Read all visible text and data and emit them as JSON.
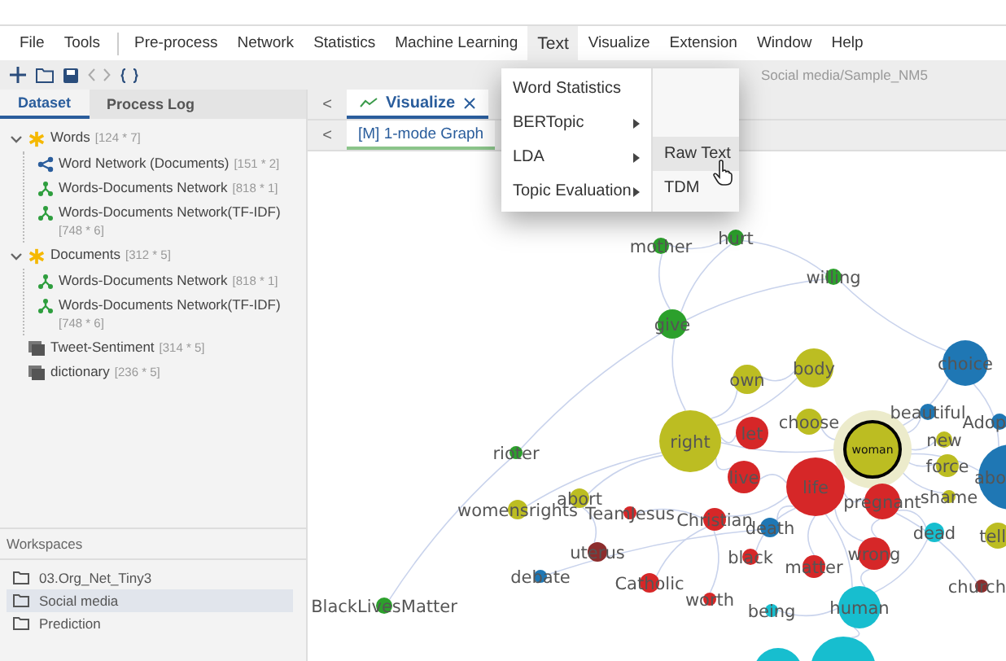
{
  "menu_bar": {
    "items": [
      {
        "label": "File",
        "kind": "item",
        "selected": false
      },
      {
        "label": "Tools",
        "kind": "item",
        "selected": false
      },
      {
        "kind": "separator"
      },
      {
        "label": "Pre-process",
        "kind": "item",
        "selected": false
      },
      {
        "label": "Network",
        "kind": "item",
        "selected": false
      },
      {
        "label": "Statistics",
        "kind": "item",
        "selected": false
      },
      {
        "label": "Machine Learning",
        "kind": "item",
        "selected": false
      },
      {
        "label": "Text",
        "kind": "item",
        "selected": true
      },
      {
        "label": "Visualize",
        "kind": "item",
        "selected": false
      },
      {
        "label": "Extension",
        "kind": "item",
        "selected": false
      },
      {
        "label": "Window",
        "kind": "item",
        "selected": false
      },
      {
        "label": "Help",
        "kind": "item",
        "selected": false
      }
    ]
  },
  "open_menu": {
    "items": [
      {
        "label": "Word Statistics",
        "kind": "item"
      },
      {
        "label": "BERTopic",
        "kind": "submenu"
      },
      {
        "label": "LDA",
        "kind": "submenu"
      },
      {
        "label": "Topic Evaluation",
        "kind": "submenu"
      }
    ]
  },
  "submenu": {
    "items": [
      {
        "label": "Raw Text",
        "selected": true
      },
      {
        "label": "TDM",
        "selected": false
      }
    ]
  },
  "breadcrumb": "Social media/Sample_NM5",
  "panel_tabs": [
    {
      "label": "Dataset",
      "selected": true
    },
    {
      "label": "Process Log",
      "selected": false
    }
  ],
  "tree": [
    {
      "label": "Words",
      "count": "[124 * 7]",
      "kind": "group",
      "expanded": true,
      "children": [
        {
          "label": "Word Network (Documents)",
          "count": "[151 * 2]",
          "kind": "network"
        },
        {
          "label": "Words-Documents Network",
          "count": "[818 * 1]",
          "kind": "bipartite"
        },
        {
          "label": "Words-Documents Network(TF-IDF)",
          "count": "[748 * 6]",
          "kind": "bipartite"
        }
      ]
    },
    {
      "label": "Documents",
      "count": "[312 * 5]",
      "kind": "group",
      "expanded": true,
      "children": [
        {
          "label": "Words-Documents Network",
          "count": "[818 * 1]",
          "kind": "bipartite"
        },
        {
          "label": "Words-Documents Network(TF-IDF)",
          "count": "[748 * 6]",
          "kind": "bipartite"
        }
      ]
    },
    {
      "label": "Tweet-Sentiment",
      "count": "[314 * 5]",
      "kind": "table"
    },
    {
      "label": "dictionary",
      "count": "[236 * 5]",
      "kind": "table"
    }
  ],
  "workspaces": {
    "title": "Workspaces",
    "items": [
      {
        "label": "03.Org_Net_Tiny3",
        "selected": false
      },
      {
        "label": "Social media",
        "selected": true
      },
      {
        "label": "Prediction",
        "selected": false
      }
    ]
  },
  "editor_tabs": {
    "scroll_button": "<",
    "tabs": [
      {
        "label": "Visualize",
        "selected": true
      }
    ]
  },
  "view_tabs": {
    "scroll_button": "<",
    "tabs": [
      {
        "label": "[M] 1-mode Graph",
        "selected": true
      }
    ]
  },
  "graph": {
    "nodes": [
      {
        "label": "mother",
        "color": "#2ca02c",
        "selected": false
      },
      {
        "label": "hurt",
        "color": "#2ca02c",
        "selected": false
      },
      {
        "label": "willing",
        "color": "#2ca02c",
        "selected": false
      },
      {
        "label": "give",
        "color": "#2ca02c",
        "selected": false
      },
      {
        "label": "own",
        "color": "#bcbd22",
        "selected": false
      },
      {
        "label": "body",
        "color": "#bcbd22",
        "selected": false
      },
      {
        "label": "choice",
        "color": "#1f77b4",
        "selected": false
      },
      {
        "label": "rioter",
        "color": "#2ca02c",
        "selected": false
      },
      {
        "label": "right",
        "color": "#bcbd22",
        "selected": false
      },
      {
        "label": "let",
        "color": "#d62728",
        "selected": false
      },
      {
        "label": "choose",
        "color": "#bcbd22",
        "selected": false
      },
      {
        "label": "woman",
        "color": "#bcbd22",
        "selected": true
      },
      {
        "label": "beautiful",
        "color": "#1f77b4",
        "selected": false
      },
      {
        "label": "new",
        "color": "#bcbd22",
        "selected": false
      },
      {
        "label": "Adop",
        "color": "#1f77b4",
        "selected": false
      },
      {
        "label": "abort",
        "color": "#bcbd22",
        "selected": false
      },
      {
        "label": "live",
        "color": "#d62728",
        "selected": false
      },
      {
        "label": "life",
        "color": "#d62728",
        "selected": false
      },
      {
        "label": "pregnant",
        "color": "#d62728",
        "selected": false
      },
      {
        "label": "force",
        "color": "#bcbd22",
        "selected": false
      },
      {
        "label": "shame",
        "color": "#bcbd22",
        "selected": false
      },
      {
        "label": "abo",
        "color": "#1f77b4",
        "selected": false
      },
      {
        "label": "womensrights",
        "color": "#bcbd22",
        "selected": false
      },
      {
        "label": "TeamJesus",
        "color": "#d62728",
        "selected": false
      },
      {
        "label": "Christian",
        "color": "#d62728",
        "selected": false
      },
      {
        "label": "death",
        "color": "#1f77b4",
        "selected": false
      },
      {
        "label": "dead",
        "color": "#17becf",
        "selected": false
      },
      {
        "label": "tell",
        "color": "#bcbd22",
        "selected": false
      },
      {
        "label": "debate",
        "color": "#1f77b4",
        "selected": false
      },
      {
        "label": "uterus",
        "color": "#8c2d2d",
        "selected": false
      },
      {
        "label": "Catholic",
        "color": "#d62728",
        "selected": false
      },
      {
        "label": "black",
        "color": "#d62728",
        "selected": false
      },
      {
        "label": "matter",
        "color": "#d62728",
        "selected": false
      },
      {
        "label": "wrong",
        "color": "#d62728",
        "selected": false
      },
      {
        "label": "church",
        "color": "#8c2d2d",
        "selected": false
      },
      {
        "label": "BlackLivesMatter",
        "color": "#2ca02c",
        "selected": false
      },
      {
        "label": "worth",
        "color": "#d62728",
        "selected": false
      },
      {
        "label": "being",
        "color": "#17becf",
        "selected": false
      },
      {
        "label": "human",
        "color": "#17becf",
        "selected": false
      },
      {
        "color": "#17becf",
        "selected": false
      },
      {
        "color": "#17becf",
        "selected": false
      }
    ]
  }
}
